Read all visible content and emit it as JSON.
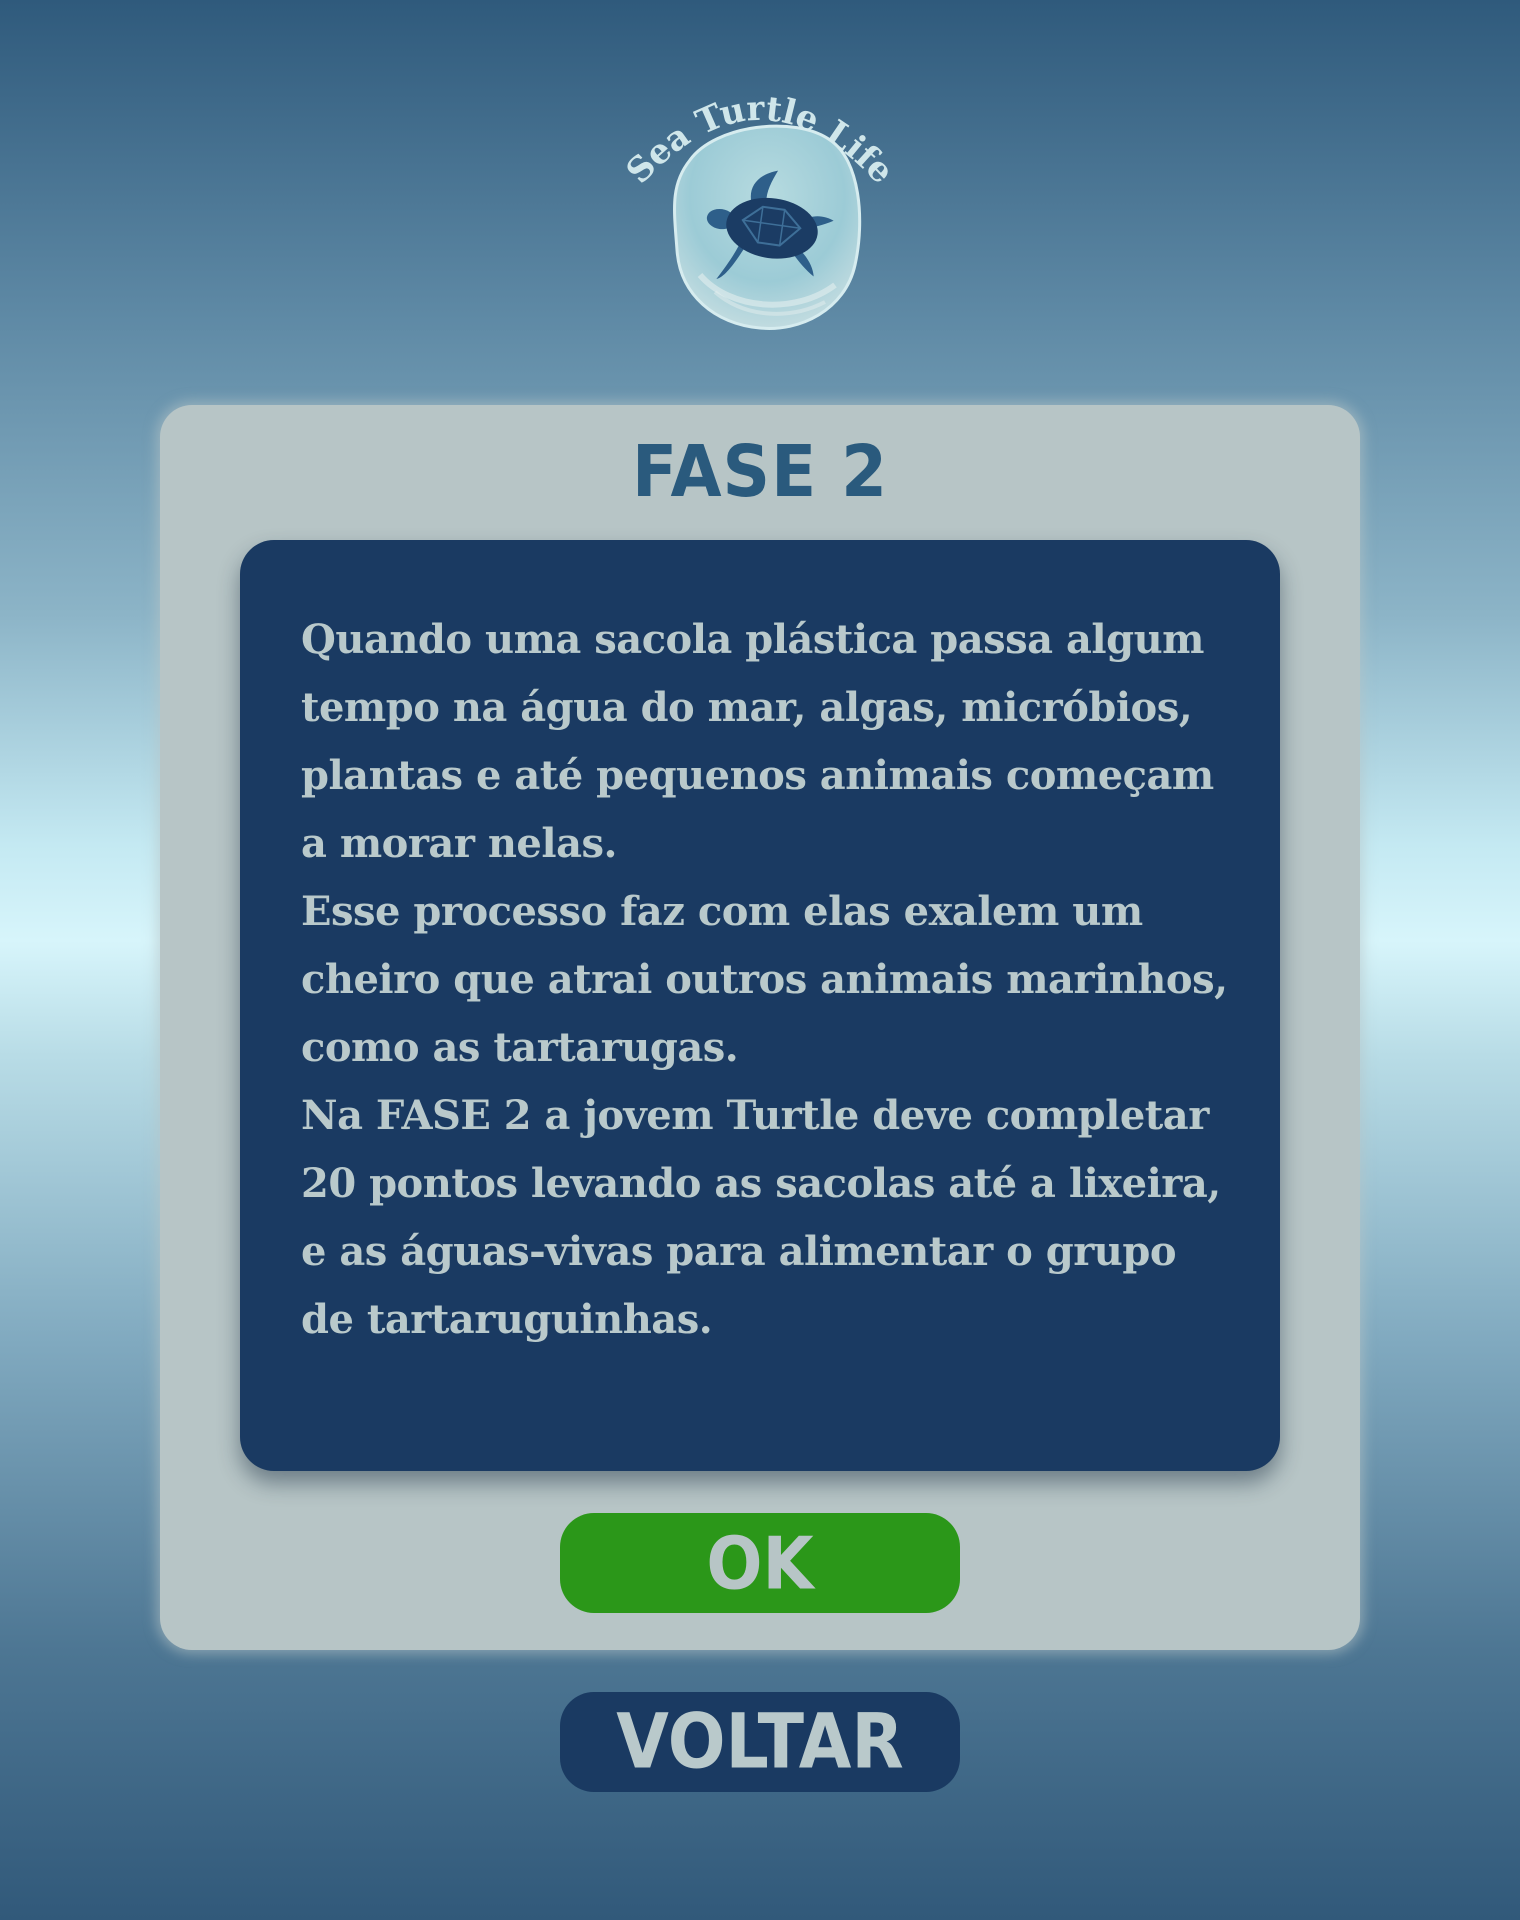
{
  "logo": {
    "text": "Sea Turtle Life",
    "icon": "sea-turtle-icon"
  },
  "dialog": {
    "title": "FASE 2",
    "body": "Quando uma sacola plástica passa algum tempo na água do mar, algas, micróbios, plantas e até pequenos animais começam a morar nelas.\nEsse processo faz com elas exalem um cheiro que atrai outros animais marinhos, como as tartarugas.\nNa FASE 2 a jovem Turtle deve completar 20 pontos levando as sacolas até a lixeira, e as águas-vivas para alimentar o grupo de tartaruguinhas.",
    "ok_label": "OK"
  },
  "back_label": "VOLTAR",
  "colors": {
    "panel": "#b7c5c6",
    "info_panel": "#1a3a62",
    "title": "#2a5a7d",
    "ok_button": "#2b9719",
    "back_button": "#1a3a62",
    "text_light": "#b9c9cb"
  }
}
